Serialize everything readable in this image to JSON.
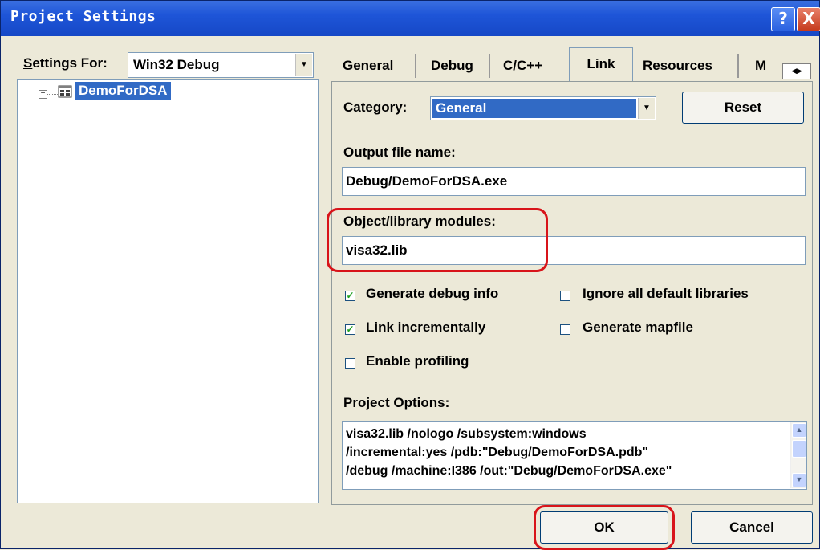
{
  "window": {
    "title": "Project Settings",
    "help_glyph": "?",
    "close_glyph": "X"
  },
  "left": {
    "settings_for_label": "Settings For:",
    "settings_for_value": "Win32 Debug",
    "tree_item": "DemoForDSA",
    "tree_expander": "+"
  },
  "tabs": [
    {
      "label": "General"
    },
    {
      "label": "Debug"
    },
    {
      "label": "C/C++"
    },
    {
      "label": "Link",
      "active": true
    },
    {
      "label": "Resources"
    },
    {
      "label": "M"
    }
  ],
  "link": {
    "category_label": "Category:",
    "category_value": "General",
    "reset_label": "Reset",
    "output_file_label": "Output file name:",
    "output_file_value": "Debug/DemoForDSA.exe",
    "object_modules_label": "Object/library modules:",
    "object_modules_value": "visa32.lib",
    "checkboxes": [
      {
        "label": "Generate debug info",
        "checked": true
      },
      {
        "label": "Ignore all default libraries",
        "checked": false
      },
      {
        "label": "Link incrementally",
        "checked": true
      },
      {
        "label": "Generate mapfile",
        "checked": false
      },
      {
        "label": "Enable profiling",
        "checked": false
      }
    ],
    "project_options_label": "Project Options:",
    "project_options_lines": [
      "visa32.lib /nologo /subsystem:windows",
      "/incremental:yes /pdb:\"Debug/DemoForDSA.pdb\"",
      "/debug /machine:I386 /out:\"Debug/DemoForDSA.exe\""
    ]
  },
  "buttons": {
    "ok": "OK",
    "cancel": "Cancel"
  },
  "colors": {
    "title_bar": "#1e55d8",
    "selection": "#316ac5",
    "highlight_box": "#d8141a",
    "dialog_bg": "#ece9d8"
  },
  "icons": {
    "help": "help-icon",
    "close": "close-icon",
    "project": "project-icon"
  }
}
